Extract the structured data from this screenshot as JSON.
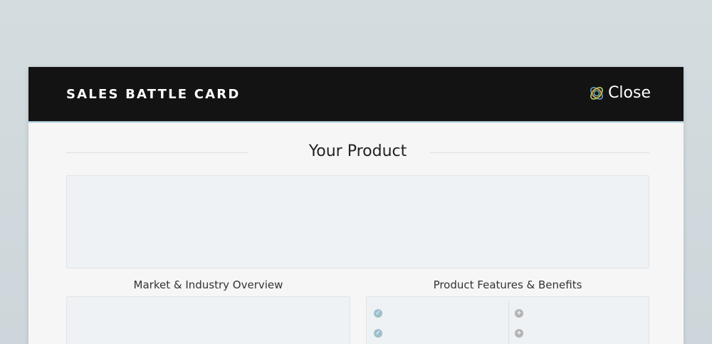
{
  "header": {
    "title": "SALES BATTLE CARD",
    "close_label": "Close"
  },
  "sections": {
    "your_product": {
      "heading": "Your Product"
    },
    "market_overview": {
      "heading": "Market & Industry Overview"
    },
    "features_benefits": {
      "heading": "Product Features & Benefits",
      "feature_icon": "check-circle-icon",
      "benefit_icon": "plus-circle-icon"
    }
  },
  "colors": {
    "header_bg": "#131313",
    "header_border": "#9ec1d0",
    "card_bg": "#f6f6f6",
    "panel_bg": "#eff2f4",
    "check_bullet": "#9fc0cc",
    "plus_bullet": "#b3b3b3"
  }
}
